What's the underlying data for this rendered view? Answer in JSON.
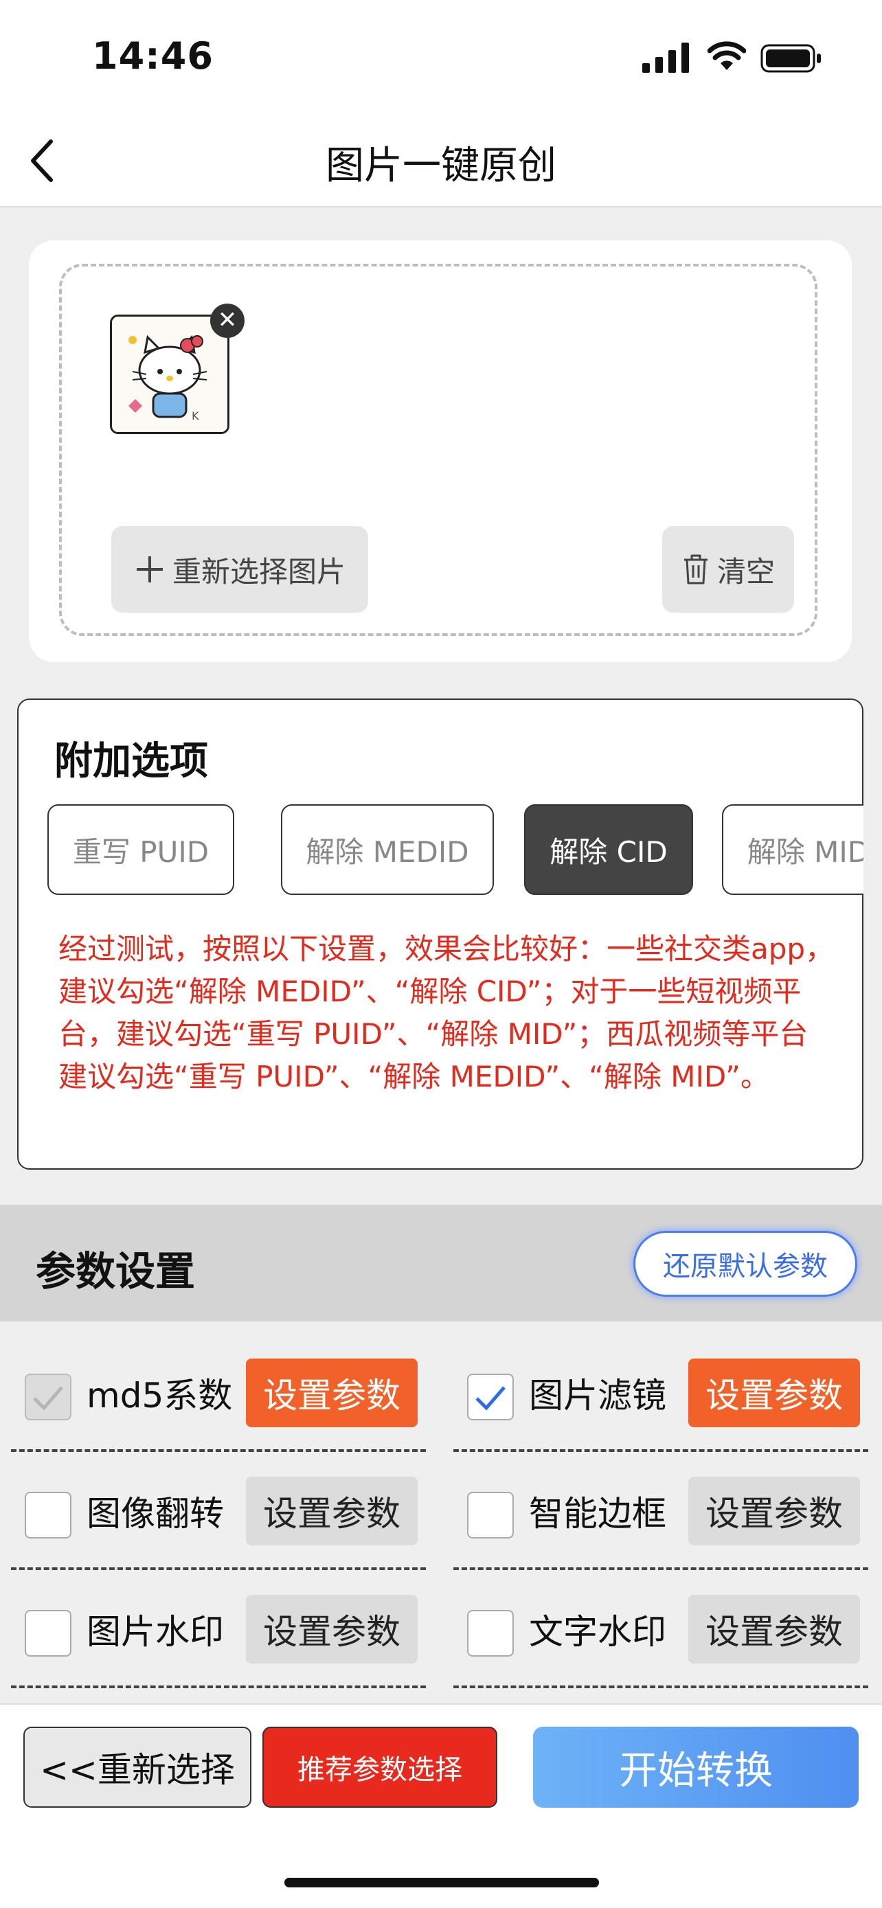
{
  "status_bar": {
    "time": "14:46"
  },
  "nav": {
    "title": "图片一键原创"
  },
  "upload": {
    "reselect_label": "重新选择图片",
    "clear_label": "清空"
  },
  "options": {
    "title": "附加选项",
    "chips": [
      {
        "label": "重写 PUID",
        "selected": false
      },
      {
        "label": "解除 MEDID",
        "selected": false
      },
      {
        "label": "解除 CID",
        "selected": true
      },
      {
        "label": "解除 MID",
        "selected": false
      }
    ],
    "note": "经过测试，按照以下设置，效果会比较好：一些社交类app，建议勾选“解除 MEDID”、“解除 CID”；对于一些短视频平台，建议勾选“重写 PUID”、“解除 MID”；西瓜视频等平台建议勾选“重写 PUID”、“解除 MEDID”、“解除 MID”。"
  },
  "params": {
    "title": "参数设置",
    "restore_label": "还原默认参数",
    "set_label": "设置参数",
    "items": [
      {
        "label": "md5系数",
        "checked": true,
        "disabled": true
      },
      {
        "label": "图片滤镜",
        "checked": true,
        "disabled": false
      },
      {
        "label": "图像翻转",
        "checked": false,
        "disabled": false
      },
      {
        "label": "智能边框",
        "checked": false,
        "disabled": false
      },
      {
        "label": "图片水印",
        "checked": false,
        "disabled": false
      },
      {
        "label": "文字水印",
        "checked": false,
        "disabled": false
      }
    ]
  },
  "bottom": {
    "reselect_label": "<<重新选择",
    "recommend_label": "推荐参数选择",
    "start_label": "开始转换"
  },
  "colors": {
    "accent_orange": "#f0622a",
    "note_red": "#e02b1d",
    "restore_blue": "#3b6ee6",
    "start_gradient": [
      "#6db3f7",
      "#4f8ff0"
    ]
  }
}
